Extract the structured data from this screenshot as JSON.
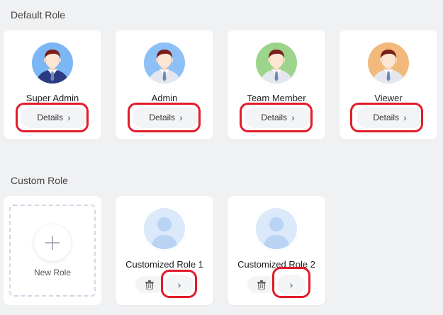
{
  "default_section": {
    "title": "Default Role"
  },
  "custom_section": {
    "title": "Custom Role"
  },
  "default_roles": [
    {
      "name": "Super Admin",
      "details_label": "Details",
      "avatar_bg": "#7cb7f5",
      "suit_color": "#2b3a82"
    },
    {
      "name": "Admin",
      "details_label": "Details",
      "avatar_bg": "#8cc0f7",
      "suit_color": "#e4e7ee"
    },
    {
      "name": "Team Member",
      "details_label": "Details",
      "avatar_bg": "#9dd48c",
      "suit_color": "#e4e7ee"
    },
    {
      "name": "Viewer",
      "details_label": "Details",
      "avatar_bg": "#f2b97c",
      "suit_color": "#e4e7ee"
    }
  ],
  "new_role": {
    "label": "New Role",
    "icon": "plus-icon"
  },
  "custom_roles": [
    {
      "name": "Customized Role 1",
      "avatar_bg": "#dbe9fa",
      "delete_icon": "trash-icon",
      "open_icon": "chevron-right-icon"
    },
    {
      "name": "Customized Role 2",
      "avatar_bg": "#dbe9fa",
      "delete_icon": "trash-icon",
      "open_icon": "chevron-right-icon"
    }
  ],
  "chevron_glyph": "›",
  "highlight_color": "#e21b2a"
}
